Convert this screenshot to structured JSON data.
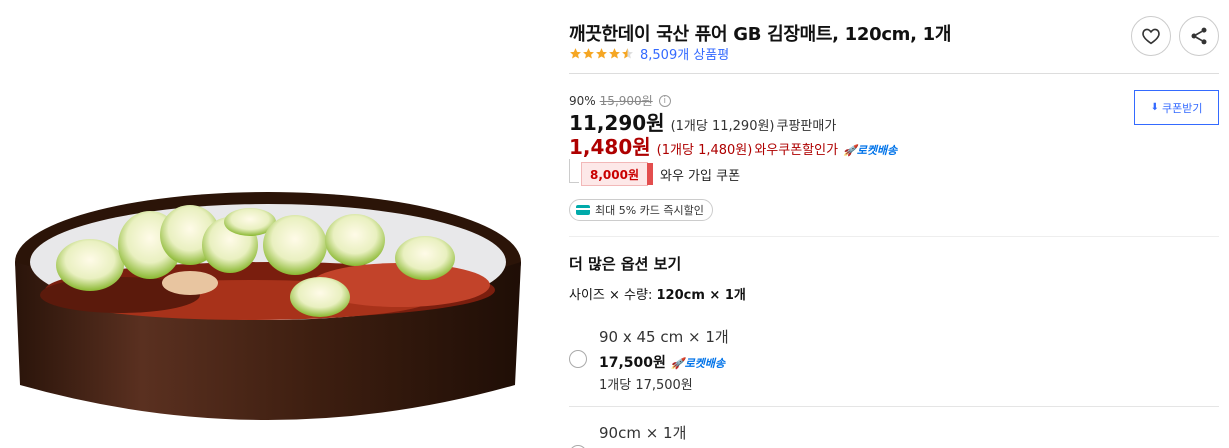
{
  "product": {
    "title": "깨끗한데이 국산 퓨어 GB 김장매트, 120cm, 1개",
    "rating": 4.5,
    "review_count": "8,509개 상품평"
  },
  "pricing": {
    "discount_rate": "90%",
    "original_price": "15,900원",
    "info_icon": "ⓘ",
    "price": "11,290원",
    "unit_price": "(1개당 11,290원)",
    "price_label": "쿠팡판매가",
    "wow_price": "1,480원",
    "wow_unit_price": "(1개당 1,480원)",
    "wow_label": "와우쿠폰할인가",
    "rocket_label": "로켓배송"
  },
  "coupon": {
    "amount": "8,000원",
    "label": "와우 가입 쿠폰",
    "download_label": "쿠폰받기"
  },
  "card": {
    "label": "최대 5% 카드 즉시할인"
  },
  "options": {
    "heading": "더 많은 옵션 보기",
    "size_label": "사이즈 × 수량:",
    "size_value": "120cm × 1개",
    "items": [
      {
        "name": "90 x 45 cm × 1개",
        "price": "17,500원",
        "rocket": "로켓배송",
        "unit_price": "1개당 17,500원"
      },
      {
        "name": "90cm × 1개"
      }
    ]
  },
  "icons": {
    "heart": "heart-icon",
    "share": "share-icon",
    "star": "star-icon",
    "rocket": "rocket-icon",
    "card": "card-icon",
    "download": "download-icon"
  },
  "colors": {
    "link": "#346aff",
    "wow": "#ae0000",
    "star": "#f5a623",
    "rocket": "#0073e9"
  }
}
